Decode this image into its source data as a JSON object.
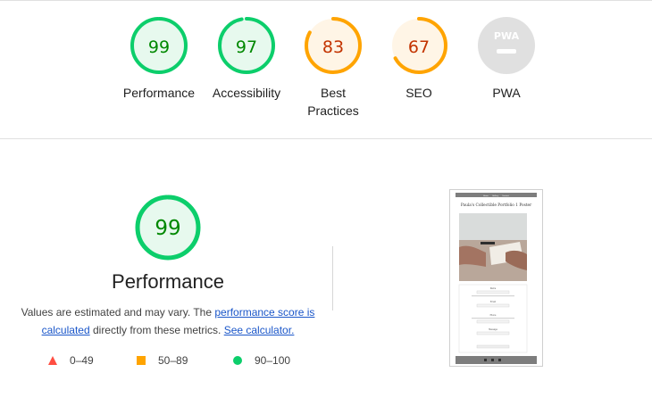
{
  "categories": [
    {
      "label": "Performance",
      "score": "99",
      "value": 99,
      "color": "#0cce6b",
      "fill": "#e7f9ee",
      "text_color": "#008800"
    },
    {
      "label": "Accessibility",
      "score": "97",
      "value": 97,
      "color": "#0cce6b",
      "fill": "#e7f9ee",
      "text_color": "#008800"
    },
    {
      "label": "Best Practices",
      "label_line1": "Best",
      "label_line2": "Practices",
      "score": "83",
      "value": 83,
      "color": "#ffa400",
      "fill": "#fff5e6",
      "text_color": "#c33300"
    },
    {
      "label": "SEO",
      "score": "67",
      "value": 67,
      "color": "#ffa400",
      "fill": "#fff5e6",
      "text_color": "#c33300"
    },
    {
      "label": "PWA",
      "badge": "PWA",
      "color": "#cccccc"
    }
  ],
  "performance": {
    "score": "99",
    "value": 99,
    "title": "Performance",
    "desc_prefix": "Values are estimated and may vary. The ",
    "link1": "performance score is calculated",
    "desc_middle": " directly from these metrics. ",
    "link2": "See calculator."
  },
  "legend": [
    {
      "label": "0–49",
      "color": "#ff4e42"
    },
    {
      "label": "50–89",
      "color": "#ffa400"
    },
    {
      "label": "90–100",
      "color": "#0cce6b"
    }
  ],
  "screenshot": {
    "page_title": "Paula's Collectible Portfolio 1 Poster",
    "nav": [
      "Home",
      "Gallery",
      "Contact"
    ],
    "form_labels": [
      "Name",
      "Email",
      "Phone",
      "Message"
    ]
  }
}
